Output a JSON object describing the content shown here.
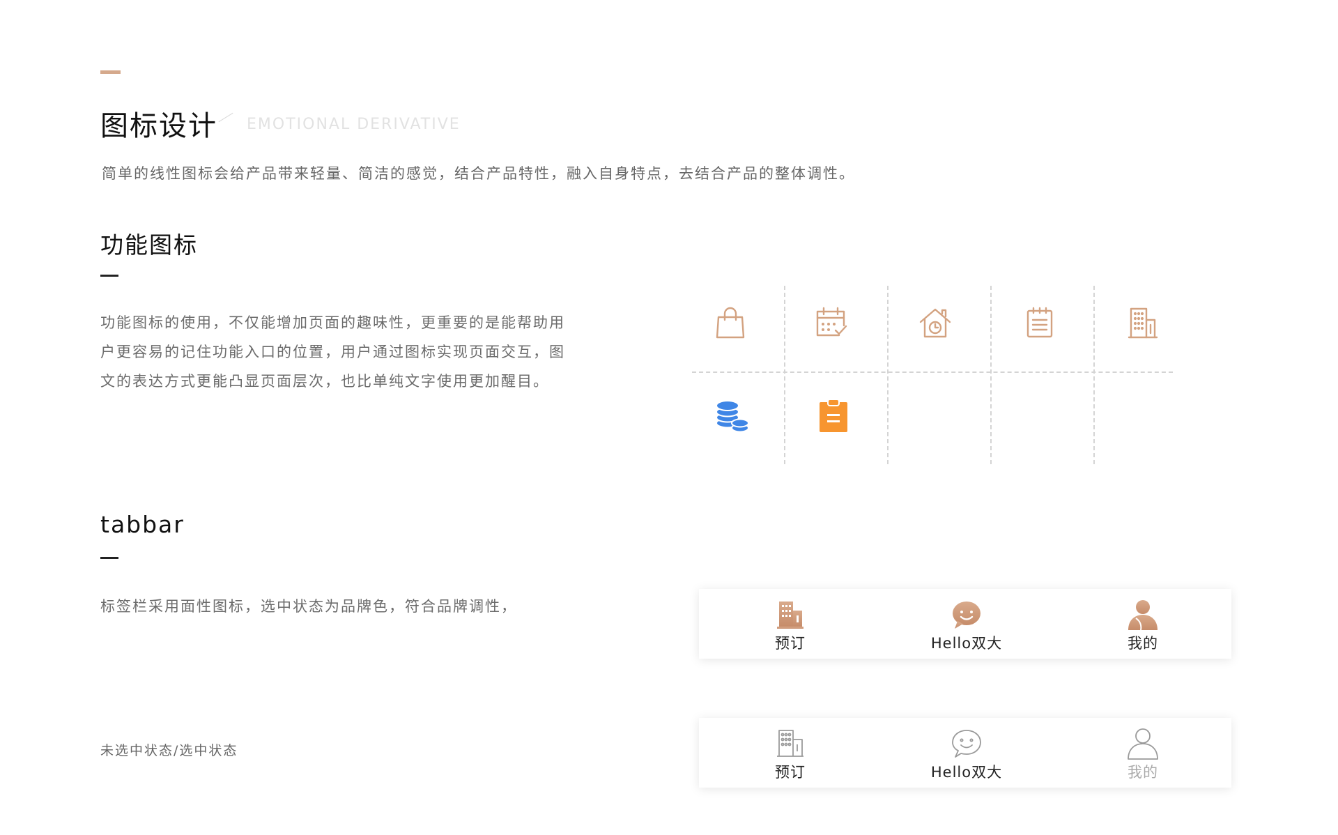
{
  "header": {
    "title": "图标设计",
    "subtitle": "EMOTIONAL DERIVATIVE",
    "intro": "简单的线性图标会给产品带来轻量、简洁的感觉，结合产品特性，融入自身特点，去结合产品的整体调性。"
  },
  "function_icons": {
    "title": "功能图标",
    "paragraph": [
      "功能图标的使用，不仅能增加页面的趣味性，更重要的是能帮助用",
      "户更容易的记住功能入口的位置，用户通过图标实现页面交互，图",
      "文的表达方式更能凸显页面层次，也比单纯文字使用更加醒目。"
    ],
    "icons": [
      {
        "name": "shopping-bag-icon",
        "style": "line",
        "color": "#d3a280"
      },
      {
        "name": "calendar-check-icon",
        "style": "line",
        "color": "#d3a280"
      },
      {
        "name": "home-clock-icon",
        "style": "line",
        "color": "#d3a280"
      },
      {
        "name": "notepad-icon",
        "style": "line",
        "color": "#d3a280"
      },
      {
        "name": "building-icon",
        "style": "line",
        "color": "#d3a280"
      },
      {
        "name": "coins-stack-icon",
        "style": "filled",
        "color": "#3f86e6"
      },
      {
        "name": "clipboard-icon",
        "style": "filled",
        "color": "#f7952f"
      }
    ]
  },
  "tabbar_section": {
    "title": "tabbar",
    "description": "标签栏采用面性图标，选中状态为品牌色，符合品牌调性，",
    "state_note": "未选中状态/选中状态",
    "selected_color": "#d3a080",
    "unselected_color": "#9a9a9a",
    "selected_tabs": [
      {
        "label": "预订",
        "icon": "building-icon"
      },
      {
        "label": "Hello双大",
        "icon": "smile-chat-icon"
      },
      {
        "label": "我的",
        "icon": "user-icon"
      }
    ],
    "unselected_tabs": [
      {
        "label": "预订",
        "icon": "building-icon"
      },
      {
        "label": "Hello双大",
        "icon": "smile-chat-icon"
      },
      {
        "label": "我的",
        "icon": "user-icon"
      }
    ]
  }
}
